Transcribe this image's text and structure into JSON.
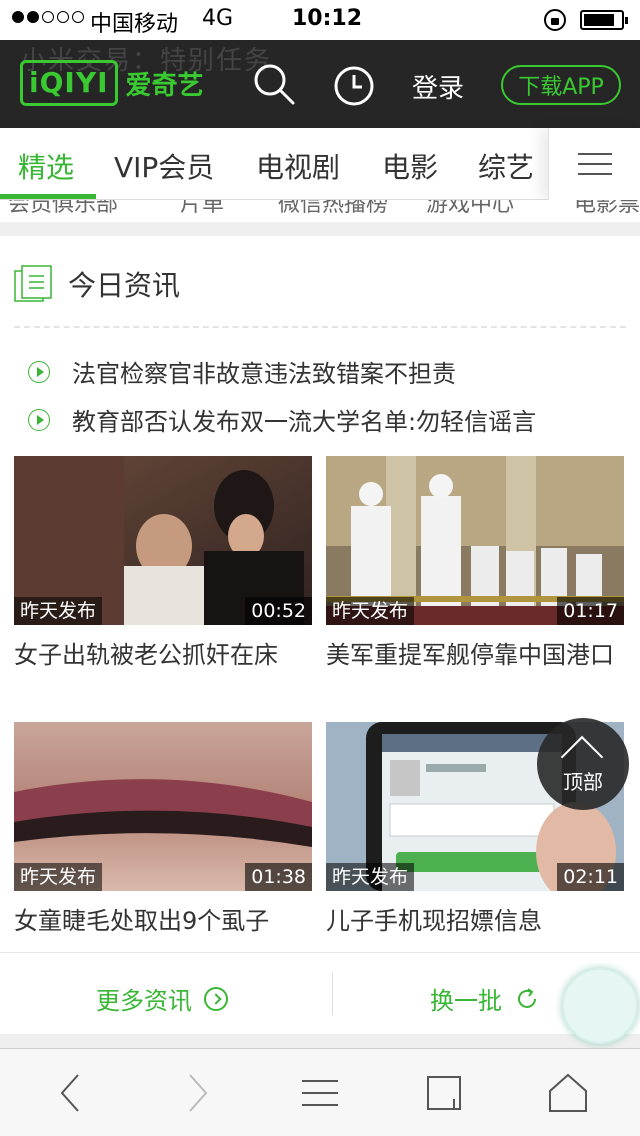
{
  "status_bar": {
    "carrier": "中国移动",
    "network": "4G",
    "time": "10:12"
  },
  "header": {
    "ghost_text": "小米交易：特别任务",
    "logo_text": "iQIYI",
    "logo_cn": "爱奇艺",
    "login_label": "登录",
    "download_label": "下载APP",
    "accent_color": "#39c930"
  },
  "tabs": [
    {
      "label": "精选",
      "active": true
    },
    {
      "label": "VIP会员",
      "active": false
    },
    {
      "label": "电视剧",
      "active": false
    },
    {
      "label": "电影",
      "active": false
    },
    {
      "label": "综艺",
      "active": false
    }
  ],
  "subnav": [
    "会员俱乐部",
    "片单",
    "微信热播榜",
    "游戏中心",
    "电影票"
  ],
  "news": {
    "section_title": "今日资讯",
    "headlines": [
      "法官检察官非故意违法致错案不担责",
      "教育部否认发布双一流大学名单:勿轻信谣言"
    ],
    "videos": [
      {
        "badge": "昨天发布",
        "duration": "00:52",
        "title": "女子出轨被老公抓奸在床"
      },
      {
        "badge": "昨天发布",
        "duration": "01:17",
        "title": "美军重提军舰停靠中国港口"
      },
      {
        "badge": "昨天发布",
        "duration": "01:38",
        "title": "女童睫毛处取出9个虱子"
      },
      {
        "badge": "昨天发布",
        "duration": "02:11",
        "title": "儿子手机现招嫖信息"
      }
    ],
    "more_label": "更多资讯",
    "refresh_label": "换一批"
  },
  "floating": {
    "top_label": "顶部"
  }
}
